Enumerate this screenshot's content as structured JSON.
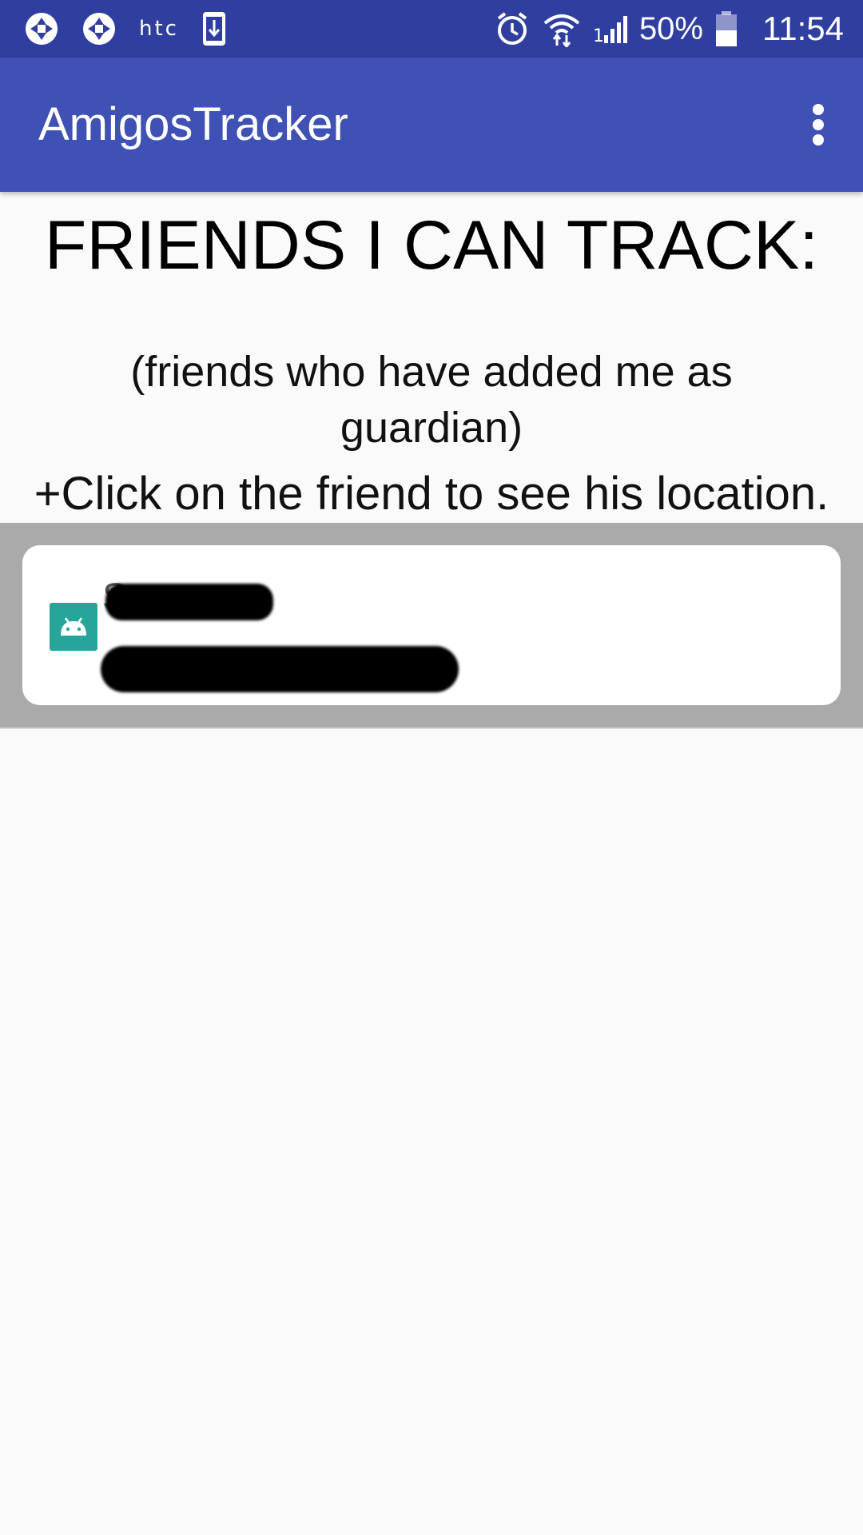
{
  "status_bar": {
    "left_icons": [
      "shutter-icon",
      "shutter-icon",
      "htc-logo",
      "download-icon"
    ],
    "htc_text": "htc",
    "right_icons": [
      "alarm-icon",
      "wifi-icon",
      "signal-icon",
      "battery-icon"
    ],
    "battery_percent": "50%",
    "battery_level": 0.5,
    "time": "11:54"
  },
  "app_bar": {
    "title": "AmigosTracker",
    "overflow_icon": "more-vert-icon"
  },
  "main": {
    "heading": "FRIENDS I CAN TRACK:",
    "subtitle": "(friends who have added me as guardian)",
    "hint": "+Click on the friend to see his location."
  },
  "friends": [
    {
      "avatar_icon": "android-icon",
      "name": "S",
      "detail": "",
      "redacted": true
    }
  ],
  "colors": {
    "status_bar": "#303f9f",
    "app_bar": "#3f51b5",
    "background": "#fafafa",
    "list_background": "#aaaaaa",
    "card": "#ffffff",
    "avatar": "#26a69a"
  }
}
